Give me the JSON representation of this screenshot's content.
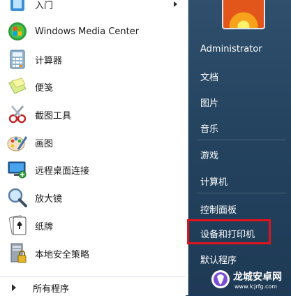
{
  "programs": [
    {
      "label": "入门",
      "icon": "getting-started-icon",
      "has_arrow": true
    },
    {
      "label": "Windows Media Center",
      "icon": "windows-media-center-icon"
    },
    {
      "label": "计算器",
      "icon": "calculator-icon"
    },
    {
      "label": "便笺",
      "icon": "sticky-notes-icon"
    },
    {
      "label": "截图工具",
      "icon": "snipping-tool-icon"
    },
    {
      "label": "画图",
      "icon": "paint-icon"
    },
    {
      "label": "远程桌面连接",
      "icon": "remote-desktop-icon"
    },
    {
      "label": "放大镜",
      "icon": "magnifier-icon"
    },
    {
      "label": "纸牌",
      "icon": "solitaire-icon"
    },
    {
      "label": "本地安全策略",
      "icon": "local-security-policy-icon"
    }
  ],
  "all_programs": "所有程序",
  "right_items": [
    {
      "label": "Administrator"
    },
    {
      "label": "文档"
    },
    {
      "label": "图片"
    },
    {
      "label": "音乐"
    },
    {
      "label": "游戏"
    },
    {
      "label": "计算机"
    },
    {
      "label": "控制面板"
    },
    {
      "label": "设备和打印机",
      "highlighted": true
    },
    {
      "label": "默认程序"
    }
  ],
  "watermark": {
    "name": "龙城安卓网",
    "url": "www.lcjrfg.com"
  },
  "colors": {
    "highlight": "#e0131c",
    "right_panel": "#24435f"
  }
}
